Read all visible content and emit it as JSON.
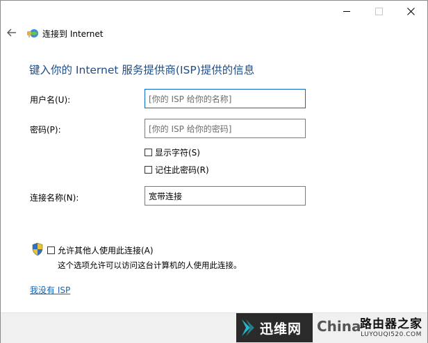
{
  "window": {
    "title": "连接到 Internet"
  },
  "heading": "键入你的 Internet 服务提供商(ISP)提供的信息",
  "form": {
    "username_label": "用户名(U):",
    "username_placeholder": "[你的 ISP 给你的名称]",
    "password_label": "密码(P):",
    "password_placeholder": "[你的 ISP 给你的密码]",
    "show_chars_label": "显示字符(S)",
    "remember_password_label": "记住此密码(R)",
    "connection_name_label": "连接名称(N):",
    "connection_name_value": "宽带连接"
  },
  "allow_others": {
    "label": "允许其他人使用此连接(A)",
    "description": "这个选项允许可以访问这台计算机的人使用此连接。"
  },
  "no_isp_link": "我没有 ISP",
  "watermark": {
    "brand_cn": "迅维网",
    "china_text": "China",
    "site_cn": "路由器之家",
    "site_en": "LUYOUQI520.COM"
  },
  "icons": {
    "back": "back-arrow-icon",
    "app": "network-globe-icon",
    "shield": "uac-shield-icon"
  }
}
